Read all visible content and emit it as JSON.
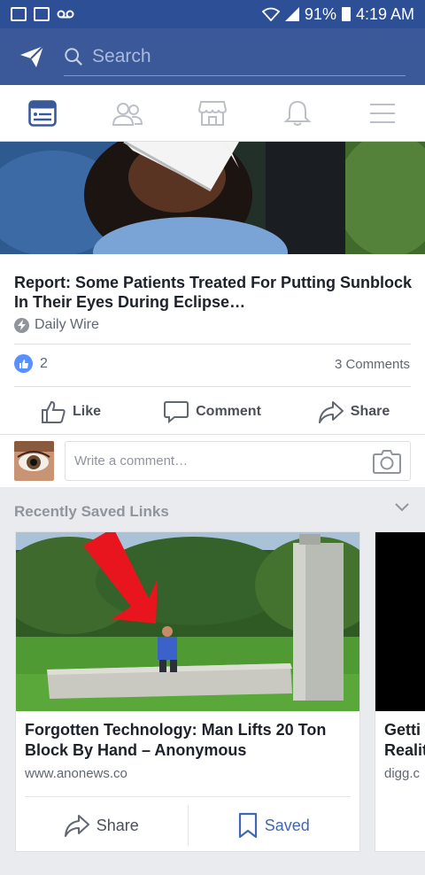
{
  "status_bar": {
    "battery": "91%",
    "time": "4:19 AM"
  },
  "search": {
    "placeholder": "Search"
  },
  "tabs": [
    {
      "name": "news-feed",
      "icon": "newsfeed-icon"
    },
    {
      "name": "friends",
      "icon": "friends-icon"
    },
    {
      "name": "marketplace",
      "icon": "marketplace-icon"
    },
    {
      "name": "notifications",
      "icon": "bell-icon"
    },
    {
      "name": "menu",
      "icon": "hamburger-icon"
    }
  ],
  "post": {
    "title": "Report: Some Patients Treated For Putting Sunblock In Their Eyes During Eclipse…",
    "source": "Daily Wire",
    "like_count": "2",
    "comments_count": "3 Comments",
    "actions": {
      "like": "Like",
      "comment": "Comment",
      "share": "Share"
    },
    "comment_placeholder": "Write a comment…"
  },
  "saved": {
    "header": "Recently Saved Links",
    "cards": [
      {
        "title": "Forgotten Technology: Man Lifts 20 Ton Block By Hand – Anonymous",
        "domain": "www.anonews.co",
        "share_label": "Share",
        "saved_label": "Saved"
      },
      {
        "title": "Getti\nRealit",
        "domain": "digg.c"
      }
    ]
  },
  "colors": {
    "brand": "#3b5998",
    "status_bar": "#2d4f95",
    "accent": "#4267b2",
    "like": "#5890ff"
  }
}
